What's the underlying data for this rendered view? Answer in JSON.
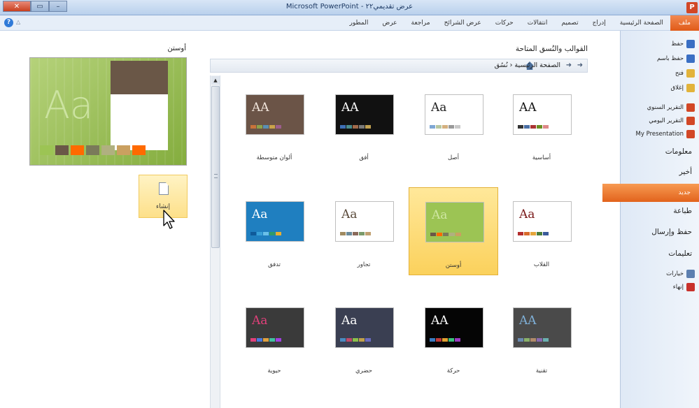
{
  "window": {
    "title": "Microsoft PowerPoint - عرض تقديمي٢٢",
    "app_icon_letter": "P"
  },
  "ribbon": {
    "tabs": [
      "ملف",
      "الصفحة الرئيسية",
      "إدراج",
      "تصميم",
      "انتقالات",
      "حركات",
      "عرض الشرائح",
      "مراجعة",
      "عرض",
      "المطور"
    ]
  },
  "nav": {
    "commands_top": [
      {
        "label": "حفظ",
        "icon": "save-icon",
        "color": "#3a6fc4"
      },
      {
        "label": "حفظ باسم",
        "icon": "save-as-icon",
        "color": "#3a6fc4"
      },
      {
        "label": "فتح",
        "icon": "open-folder-icon",
        "color": "#e2b33b"
      },
      {
        "label": "إغلاق",
        "icon": "close-folder-icon",
        "color": "#e2b33b"
      }
    ],
    "recent_files": [
      {
        "label": "التقرير السنوي",
        "icon": "presentation-file-icon",
        "color": "#d24726"
      },
      {
        "label": "التقرير اليومي",
        "icon": "presentation-file-icon",
        "color": "#d24726"
      },
      {
        "label": "My Presentation",
        "icon": "presentation-file-icon",
        "color": "#d24726"
      }
    ],
    "tabs": {
      "info": "معلومات",
      "recent": "أخير",
      "new": "جديد",
      "print": "طباعة",
      "save_send": "حفظ وإرسال",
      "help": "تعليمات"
    },
    "commands_bottom": [
      {
        "label": "خيارات",
        "icon": "options-icon",
        "color": "#5c7fb0"
      },
      {
        "label": "إنهاء",
        "icon": "exit-icon",
        "color": "#c8312b"
      }
    ]
  },
  "gallery": {
    "title": "القوالب والنُسق المتاحة",
    "breadcrumb": "الصفحة الرئيسية ‹ نُسُق",
    "themes": [
      {
        "label": "أساسية",
        "aa": "AA",
        "bg": "#ffffff",
        "fg": "#111111",
        "sw": [
          "#333333",
          "#4a6fa5",
          "#a33",
          "#6b8e23",
          "#d88"
        ],
        "selected": false
      },
      {
        "label": "أصل",
        "aa": "Aa",
        "bg": "#ffffff",
        "fg": "#222222",
        "sw": [
          "#7fa7d4",
          "#b8c7a0",
          "#d4b07f",
          "#999",
          "#c9c9c9"
        ],
        "selected": false
      },
      {
        "label": "أفق",
        "aa": "AA",
        "bg": "#111111",
        "fg": "#ffffff",
        "sw": [
          "#3d6fb6",
          "#4a8c8c",
          "#a06a4a",
          "#7a7a7a",
          "#c0a050"
        ],
        "selected": false
      },
      {
        "label": "ألوان متوسطة",
        "aa": "AA",
        "bg": "#6b5447",
        "fg": "#f2e6dc",
        "sw": [
          "#c9733a",
          "#8da34a",
          "#5a8fb3",
          "#c9a24a",
          "#9c5e8c"
        ],
        "selected": false
      },
      {
        "label": "القلاب",
        "aa": "Aa",
        "bg": "#ffffff",
        "fg": "#7a1a1a",
        "sw": [
          "#b32d2d",
          "#d96b2b",
          "#e5a53a",
          "#4a7d3a",
          "#3a5a9a"
        ],
        "selected": false
      },
      {
        "label": "أوستن",
        "aa": "Aa",
        "bg": "#9cc454",
        "fg": "#cfe6a3",
        "sw": [
          "#6a5747",
          "#ff6a00",
          "#7a7a5a",
          "#b0b080",
          "#caa060"
        ],
        "selected": true
      },
      {
        "label": "تجاور",
        "aa": "Aa",
        "bg": "#ffffff",
        "fg": "#5a4a3a",
        "sw": [
          "#a08a60",
          "#6a8a9a",
          "#8a6a5a",
          "#7a9a6a",
          "#c0a070"
        ],
        "selected": false
      },
      {
        "label": "تدفق",
        "aa": "Aa",
        "bg": "#1f7fc0",
        "fg": "#ffffff",
        "sw": [
          "#0f5a9a",
          "#39a0d8",
          "#6ac0e8",
          "#2f9a6a",
          "#e8b030"
        ],
        "selected": false
      },
      {
        "label": "تقنية",
        "aa": "AA",
        "bg": "#4a4a4a",
        "fg": "#7fb0d8",
        "sw": [
          "#6a8ab0",
          "#8ab06a",
          "#b08a6a",
          "#8a6ab0",
          "#6ab0b0"
        ],
        "selected": false
      },
      {
        "label": "حركة",
        "aa": "AA",
        "bg": "#050505",
        "fg": "#ffffff",
        "sw": [
          "#3a7ac0",
          "#c03a3a",
          "#e0a030",
          "#3ac07a",
          "#9a3ac0"
        ],
        "selected": false
      },
      {
        "label": "حضري",
        "aa": "Aa",
        "bg": "#3a3f52",
        "fg": "#ffffff",
        "sw": [
          "#4a8ac0",
          "#c04a6a",
          "#8ac04a",
          "#c0a04a",
          "#6a6ac0"
        ],
        "selected": false
      },
      {
        "label": "حيوية",
        "aa": "Aa",
        "bg": "#3a3a3a",
        "fg": "#e0407a",
        "sw": [
          "#e0407a",
          "#4a7ae0",
          "#e0a040",
          "#40c0a0",
          "#a040e0"
        ],
        "selected": false
      }
    ]
  },
  "preview": {
    "title": "أوستن",
    "aa": "Aa",
    "swatches": [
      "#9cc454",
      "#6a5747",
      "#ff6a00",
      "#7a7a5a",
      "#b0b080",
      "#caa060",
      "#ff6a00"
    ],
    "create_label": "إنشاء"
  }
}
